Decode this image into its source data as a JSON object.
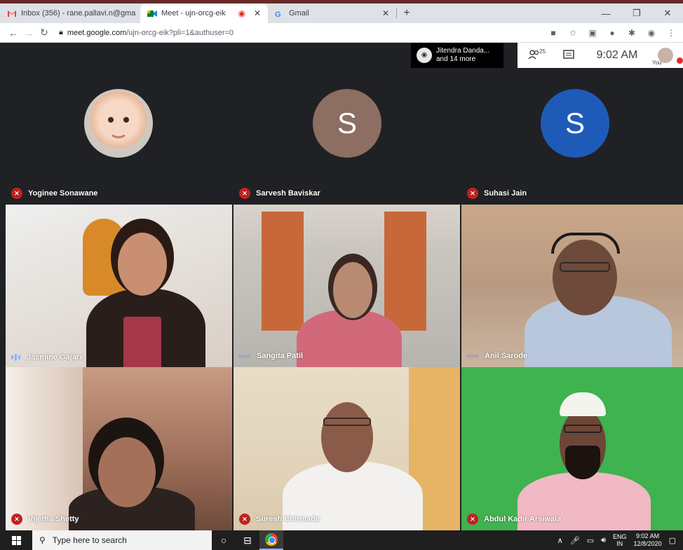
{
  "browser": {
    "tabs": [
      {
        "icon": "gmail-icon",
        "title": "Inbox (356) - rane.pallavi.n@gma",
        "active": false
      },
      {
        "icon": "meet-icon",
        "title": "Meet - ujn-orcg-eik",
        "active": true,
        "recording": true
      },
      {
        "icon": "google-icon",
        "title": "Gmail",
        "active": false
      }
    ],
    "url_host": "meet.google.com",
    "url_path": "/ujn-orcg-eik?pli=1&authuser=0"
  },
  "meet": {
    "presenter_name": "Jitendra Danda...",
    "presenter_more": "and 14 more",
    "people_count": "25",
    "time": "9:02 AM",
    "you_label": "You",
    "colors": {
      "mute_red": "#c5221f",
      "avatar_brown": "#8d6e63",
      "avatar_blue": "#1e5bb8",
      "green_screen": "#3fb34f"
    },
    "tiles": [
      {
        "name": "Yoginee Sonawane",
        "status": "muted",
        "avatar": "photo"
      },
      {
        "name": "Sarvesh Baviskar",
        "status": "muted",
        "avatar_letter": "S"
      },
      {
        "name": "Suhasi Jain",
        "status": "muted",
        "avatar_letter": "S"
      },
      {
        "name": "Jasmine Gajare",
        "status": "speaking"
      },
      {
        "name": "Sangita Patil",
        "status": "more"
      },
      {
        "name": "Anil Sarode",
        "status": "more"
      },
      {
        "name": "Vijetha Shetty",
        "status": "muted"
      },
      {
        "name": "Suresh Chirmade",
        "status": "muted"
      },
      {
        "name": "Abdul Kadir Arsiwala",
        "status": "muted"
      }
    ]
  },
  "taskbar": {
    "search_placeholder": "Type here to search",
    "lang_top": "ENG",
    "lang_bottom": "IN",
    "clock_time": "9:02 AM",
    "clock_date": "12/8/2020"
  }
}
